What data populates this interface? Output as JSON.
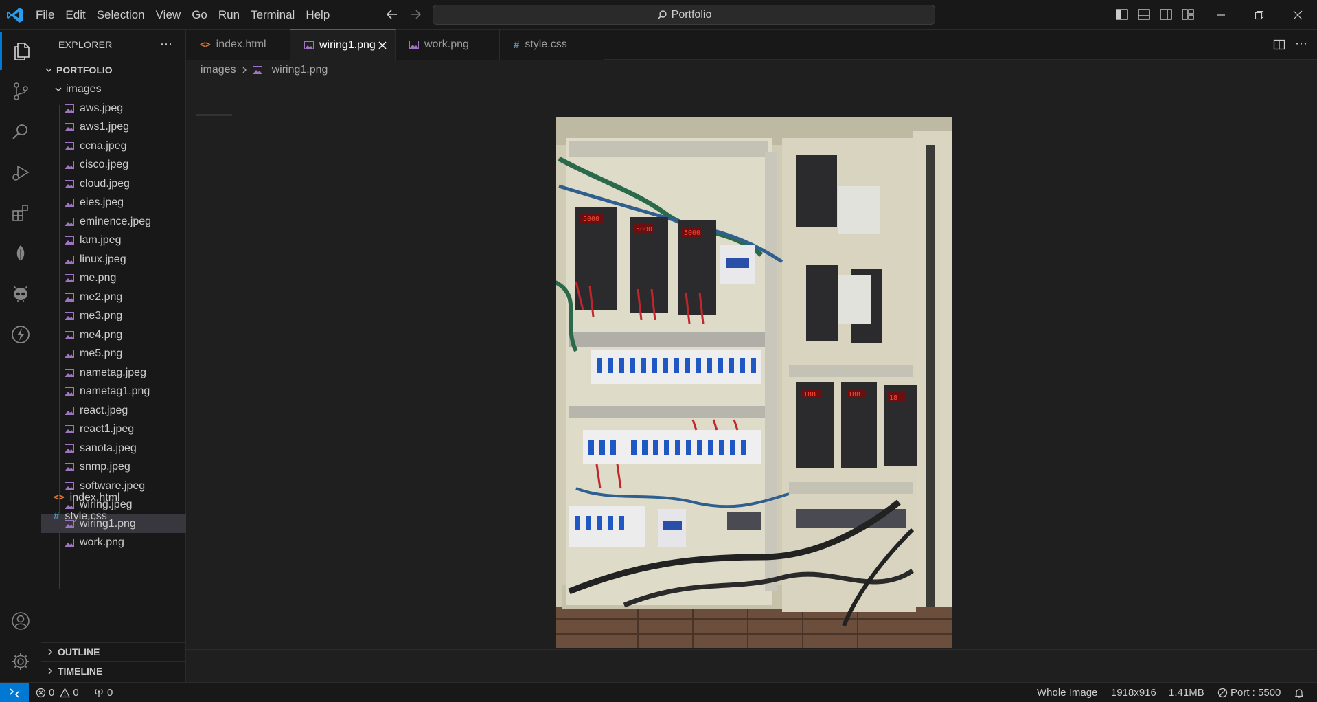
{
  "menu": [
    "File",
    "Edit",
    "Selection",
    "View",
    "Go",
    "Run",
    "Terminal",
    "Help"
  ],
  "search": {
    "label": "Portfolio"
  },
  "sidebar": {
    "title": "EXPLORER",
    "root": "PORTFOLIO",
    "folder": "images",
    "images": [
      "aws.jpeg",
      "aws1.jpeg",
      "ccna.jpeg",
      "cisco.jpeg",
      "cloud.jpeg",
      "eies.jpeg",
      "eminence.jpeg",
      "lam.jpeg",
      "linux.jpeg",
      "me.png",
      "me2.png",
      "me3.png",
      "me4.png",
      "me5.png",
      "nametag.jpeg",
      "nametag1.png",
      "react.jpeg",
      "react1.jpeg",
      "sanota.jpeg",
      "snmp.jpeg",
      "software.jpeg",
      "wiring.jpeg",
      "wiring1.png",
      "work.png"
    ],
    "selected": "wiring1.png",
    "root_files": [
      {
        "name": "index.html",
        "icon": "html-file-icon"
      },
      {
        "name": "style.css",
        "icon": "css-file-icon"
      }
    ],
    "outline": "OUTLINE",
    "timeline": "TIMELINE"
  },
  "tabs": [
    {
      "label": "index.html",
      "icon": "html-file-icon",
      "active": false
    },
    {
      "label": "wiring1.png",
      "icon": "image-file-icon",
      "active": true
    },
    {
      "label": "work.png",
      "icon": "image-file-icon",
      "active": false
    },
    {
      "label": "style.css",
      "icon": "css-file-icon",
      "active": false
    }
  ],
  "breadcrumb": {
    "folder": "images",
    "file": "wiring1.png"
  },
  "status": {
    "errors": "0",
    "warnings": "0",
    "ports_forwarded": "0",
    "zoom": "Whole Image",
    "dimensions": "1918x916",
    "size": "1.41MB",
    "port": "Port : 5500"
  },
  "colors": {
    "accent": "#0078d4",
    "background": "#1f1f1f",
    "sidebar": "#181818",
    "selection": "#37373d",
    "image_icon": "#a074c4",
    "html_icon": "#e37933",
    "css_icon": "#519aba"
  }
}
